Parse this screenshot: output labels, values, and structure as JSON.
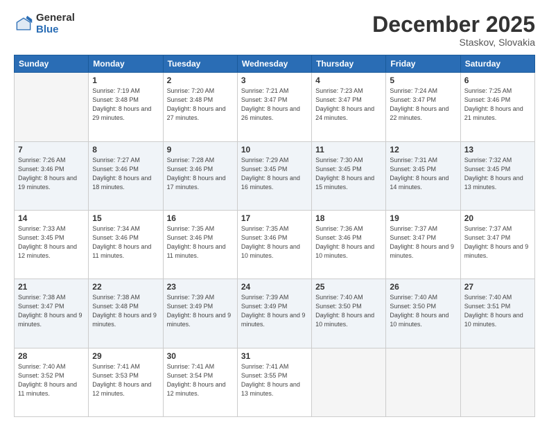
{
  "header": {
    "logo_general": "General",
    "logo_blue": "Blue",
    "month_title": "December 2025",
    "location": "Staskov, Slovakia"
  },
  "weekdays": [
    "Sunday",
    "Monday",
    "Tuesday",
    "Wednesday",
    "Thursday",
    "Friday",
    "Saturday"
  ],
  "weeks": [
    [
      {
        "day": "",
        "empty": true
      },
      {
        "day": "1",
        "sunrise": "7:19 AM",
        "sunset": "3:48 PM",
        "daylight": "8 hours and 29 minutes."
      },
      {
        "day": "2",
        "sunrise": "7:20 AM",
        "sunset": "3:48 PM",
        "daylight": "8 hours and 27 minutes."
      },
      {
        "day": "3",
        "sunrise": "7:21 AM",
        "sunset": "3:47 PM",
        "daylight": "8 hours and 26 minutes."
      },
      {
        "day": "4",
        "sunrise": "7:23 AM",
        "sunset": "3:47 PM",
        "daylight": "8 hours and 24 minutes."
      },
      {
        "day": "5",
        "sunrise": "7:24 AM",
        "sunset": "3:47 PM",
        "daylight": "8 hours and 22 minutes."
      },
      {
        "day": "6",
        "sunrise": "7:25 AM",
        "sunset": "3:46 PM",
        "daylight": "8 hours and 21 minutes."
      }
    ],
    [
      {
        "day": "7",
        "sunrise": "7:26 AM",
        "sunset": "3:46 PM",
        "daylight": "8 hours and 19 minutes."
      },
      {
        "day": "8",
        "sunrise": "7:27 AM",
        "sunset": "3:46 PM",
        "daylight": "8 hours and 18 minutes."
      },
      {
        "day": "9",
        "sunrise": "7:28 AM",
        "sunset": "3:46 PM",
        "daylight": "8 hours and 17 minutes."
      },
      {
        "day": "10",
        "sunrise": "7:29 AM",
        "sunset": "3:45 PM",
        "daylight": "8 hours and 16 minutes."
      },
      {
        "day": "11",
        "sunrise": "7:30 AM",
        "sunset": "3:45 PM",
        "daylight": "8 hours and 15 minutes."
      },
      {
        "day": "12",
        "sunrise": "7:31 AM",
        "sunset": "3:45 PM",
        "daylight": "8 hours and 14 minutes."
      },
      {
        "day": "13",
        "sunrise": "7:32 AM",
        "sunset": "3:45 PM",
        "daylight": "8 hours and 13 minutes."
      }
    ],
    [
      {
        "day": "14",
        "sunrise": "7:33 AM",
        "sunset": "3:45 PM",
        "daylight": "8 hours and 12 minutes."
      },
      {
        "day": "15",
        "sunrise": "7:34 AM",
        "sunset": "3:46 PM",
        "daylight": "8 hours and 11 minutes."
      },
      {
        "day": "16",
        "sunrise": "7:35 AM",
        "sunset": "3:46 PM",
        "daylight": "8 hours and 11 minutes."
      },
      {
        "day": "17",
        "sunrise": "7:35 AM",
        "sunset": "3:46 PM",
        "daylight": "8 hours and 10 minutes."
      },
      {
        "day": "18",
        "sunrise": "7:36 AM",
        "sunset": "3:46 PM",
        "daylight": "8 hours and 10 minutes."
      },
      {
        "day": "19",
        "sunrise": "7:37 AM",
        "sunset": "3:47 PM",
        "daylight": "8 hours and 9 minutes."
      },
      {
        "day": "20",
        "sunrise": "7:37 AM",
        "sunset": "3:47 PM",
        "daylight": "8 hours and 9 minutes."
      }
    ],
    [
      {
        "day": "21",
        "sunrise": "7:38 AM",
        "sunset": "3:47 PM",
        "daylight": "8 hours and 9 minutes."
      },
      {
        "day": "22",
        "sunrise": "7:38 AM",
        "sunset": "3:48 PM",
        "daylight": "8 hours and 9 minutes."
      },
      {
        "day": "23",
        "sunrise": "7:39 AM",
        "sunset": "3:49 PM",
        "daylight": "8 hours and 9 minutes."
      },
      {
        "day": "24",
        "sunrise": "7:39 AM",
        "sunset": "3:49 PM",
        "daylight": "8 hours and 9 minutes."
      },
      {
        "day": "25",
        "sunrise": "7:40 AM",
        "sunset": "3:50 PM",
        "daylight": "8 hours and 10 minutes."
      },
      {
        "day": "26",
        "sunrise": "7:40 AM",
        "sunset": "3:50 PM",
        "daylight": "8 hours and 10 minutes."
      },
      {
        "day": "27",
        "sunrise": "7:40 AM",
        "sunset": "3:51 PM",
        "daylight": "8 hours and 10 minutes."
      }
    ],
    [
      {
        "day": "28",
        "sunrise": "7:40 AM",
        "sunset": "3:52 PM",
        "daylight": "8 hours and 11 minutes."
      },
      {
        "day": "29",
        "sunrise": "7:41 AM",
        "sunset": "3:53 PM",
        "daylight": "8 hours and 12 minutes."
      },
      {
        "day": "30",
        "sunrise": "7:41 AM",
        "sunset": "3:54 PM",
        "daylight": "8 hours and 12 minutes."
      },
      {
        "day": "31",
        "sunrise": "7:41 AM",
        "sunset": "3:55 PM",
        "daylight": "8 hours and 13 minutes."
      },
      {
        "day": "",
        "empty": true
      },
      {
        "day": "",
        "empty": true
      },
      {
        "day": "",
        "empty": true
      }
    ]
  ]
}
